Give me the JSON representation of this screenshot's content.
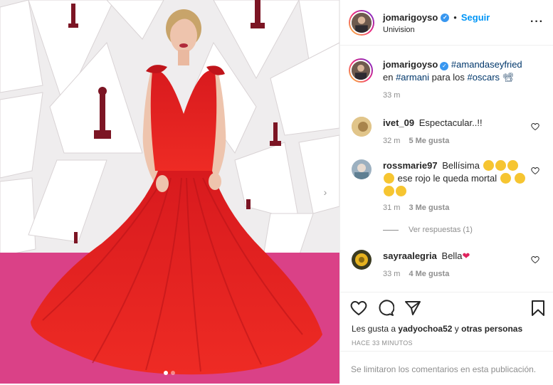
{
  "header": {
    "username": "jomarigoyso",
    "follow_label": "Seguir",
    "separator": "•",
    "location": "Univision",
    "more_label": "···"
  },
  "caption": {
    "username": "jomarigoyso",
    "parts": [
      "#amandaseyfried",
      " en ",
      "#armani",
      " para los ",
      "#oscars"
    ],
    "time": "33 m"
  },
  "comments": [
    {
      "username": "ivet_09",
      "text": "Espectacular..!!",
      "time": "32 m",
      "likes": "5 Me gusta"
    },
    {
      "username": "rossmarie97",
      "text_a": "Bellísima",
      "text_b": "ese rojo le queda mortal",
      "time": "31 m",
      "likes": "3 Me gusta",
      "replies": "Ver respuestas (1)"
    },
    {
      "username": "sayraalegria",
      "text": "Bella",
      "time": "33 m",
      "likes": "4 Me gusta"
    }
  ],
  "footer": {
    "likes_prefix": "Les gusta a ",
    "likes_user": "yadyochoa52",
    "likes_middle": " y ",
    "likes_others": "otras personas",
    "timestamp": "HACE 33 MINUTOS",
    "comments_limited": "Se limitaron los comentarios en esta publicación."
  },
  "colors": {
    "link": "#00376b",
    "follow": "#0095f6",
    "dress": "#e41d1d",
    "carpet": "#e0448c"
  },
  "icons": [
    "more-icon",
    "verified-icon",
    "heart-icon",
    "comment-icon",
    "share-icon",
    "save-icon",
    "chevron-right-icon"
  ]
}
